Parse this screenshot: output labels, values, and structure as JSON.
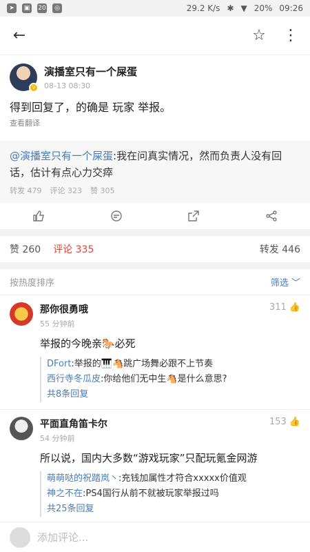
{
  "status": {
    "speed": "29.2 K/s",
    "battery": "20%",
    "time": "09:26"
  },
  "nav": {
    "back": "←",
    "star": "☆",
    "more": "⋮"
  },
  "post": {
    "author": "演播室只有一个屎蛋",
    "time": "08-13 08:30",
    "text": "得到回复了，的确是 玩家 举报。",
    "translate": "查看翻译",
    "repost_mention": "@演播室只有一个屎蛋",
    "repost_text": ":我在问真实情况，然而负责人没有回话，估计有点心力交瘁",
    "repost_stats": {
      "forward": "转发 479",
      "comment": "评论 323",
      "like": "赞 305"
    }
  },
  "tabs": {
    "like": "赞",
    "like_count": "260",
    "comment": "评论",
    "comment_count": "335",
    "forward": "转发",
    "forward_count": "446"
  },
  "sort": {
    "label": "按热度排序",
    "filter": "筛选"
  },
  "comments": [
    {
      "name": "那你很勇哦",
      "time": "55 分钟前",
      "likes": "311",
      "text": "举报的今晚亲🐎必死",
      "replies": [
        {
          "name": "DFort",
          "text": ":举报的🎹🐴跳广场舞必跟不上节奏"
        },
        {
          "name": "西行寺冬瓜皮",
          "text": ":你给他们无中生🐴是什么意思?"
        }
      ],
      "more": "共8条回复"
    },
    {
      "name": "平面直角笛卡尔",
      "time": "54 分钟前",
      "likes": "153",
      "text": "所以说，国内大多数“游戏玩家”只配玩氪金网游",
      "replies": [
        {
          "name": "萌萌哒的祝踏岚丶",
          "text": ":充钱加属性才符合xxxxx价值观"
        },
        {
          "name": "神之不在",
          "text": ":PS4国行从前不就被玩家举报过吗"
        }
      ],
      "more": "共25条回复"
    }
  ],
  "bottom": {
    "placeholder": "添加评论..."
  },
  "colors": {
    "accent": "#e8432e",
    "link": "#4a7bb7"
  }
}
